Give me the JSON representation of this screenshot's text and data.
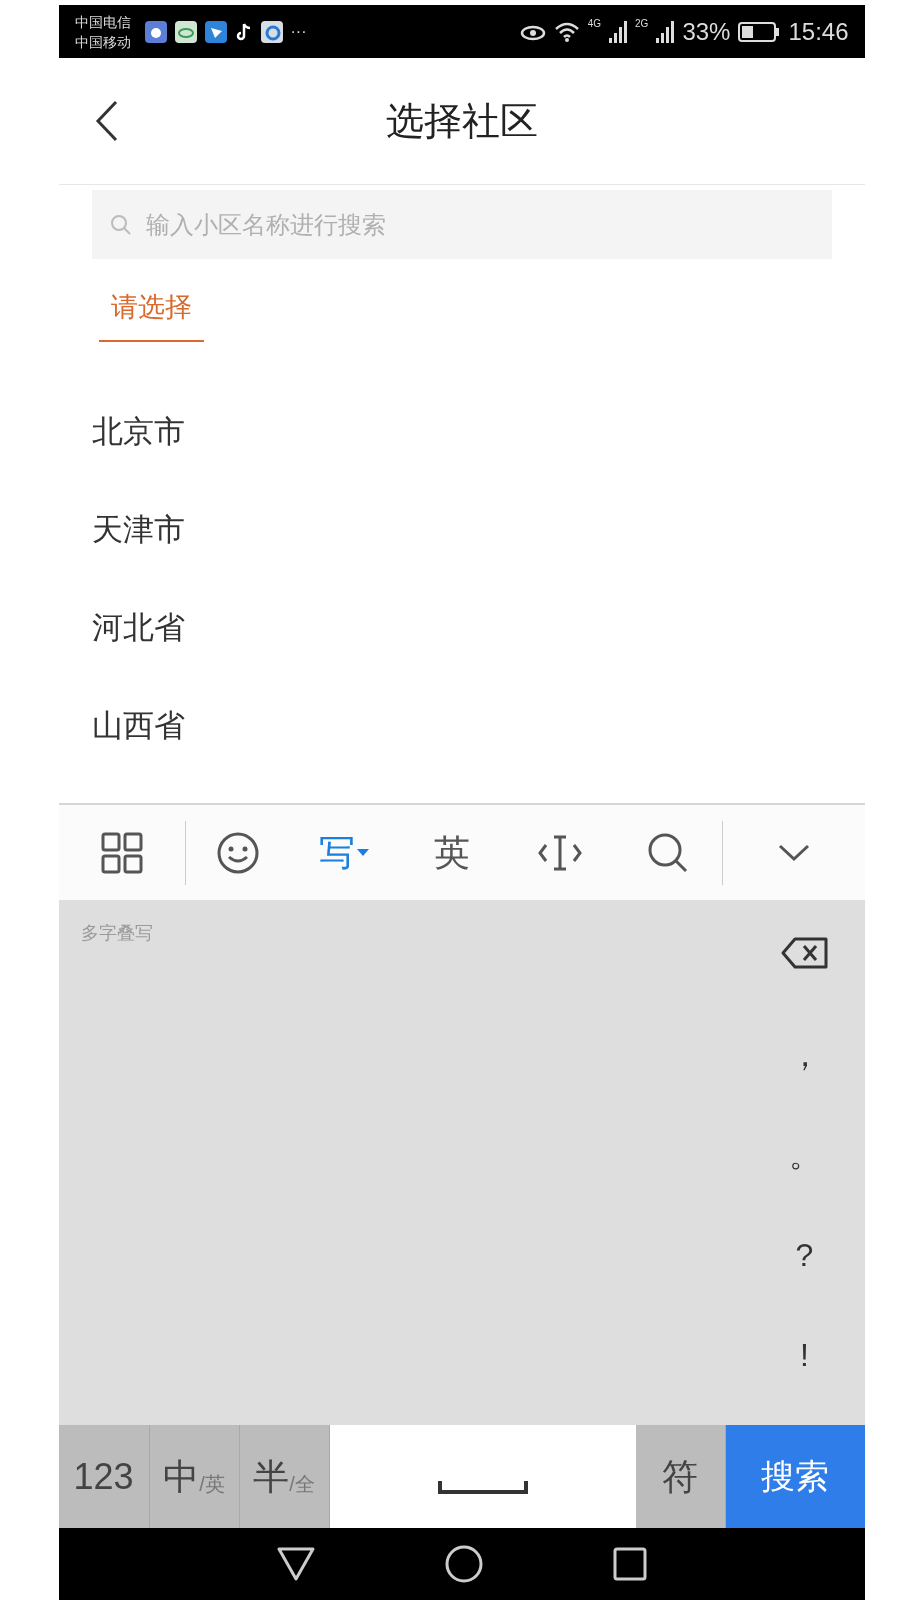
{
  "status_bar": {
    "carriers": [
      "中国电信",
      "中国移动"
    ],
    "more": "···",
    "network_1": "4G",
    "network_2": "2G",
    "battery": "33%",
    "time": "15:46"
  },
  "header": {
    "title": "选择社区"
  },
  "search": {
    "placeholder": "输入小区名称进行搜索"
  },
  "tabs": [
    {
      "label": "请选择",
      "selected": true
    }
  ],
  "regions": [
    "北京市",
    "天津市",
    "河北省",
    "山西省"
  ],
  "keyboard": {
    "modes": [
      {
        "label": "写",
        "selected": true
      },
      {
        "label": "英",
        "selected": false
      }
    ],
    "hint": "多字叠写",
    "punctuation": [
      "，",
      "。",
      "?",
      "!"
    ],
    "keys": [
      {
        "kind": "plain",
        "label": "123"
      },
      {
        "kind": "split",
        "label": "中",
        "sub": "/英"
      },
      {
        "kind": "split",
        "label": "半",
        "sub": "/全"
      },
      {
        "kind": "space"
      },
      {
        "kind": "plain",
        "label": "符"
      },
      {
        "kind": "action",
        "label": "搜索"
      }
    ]
  }
}
